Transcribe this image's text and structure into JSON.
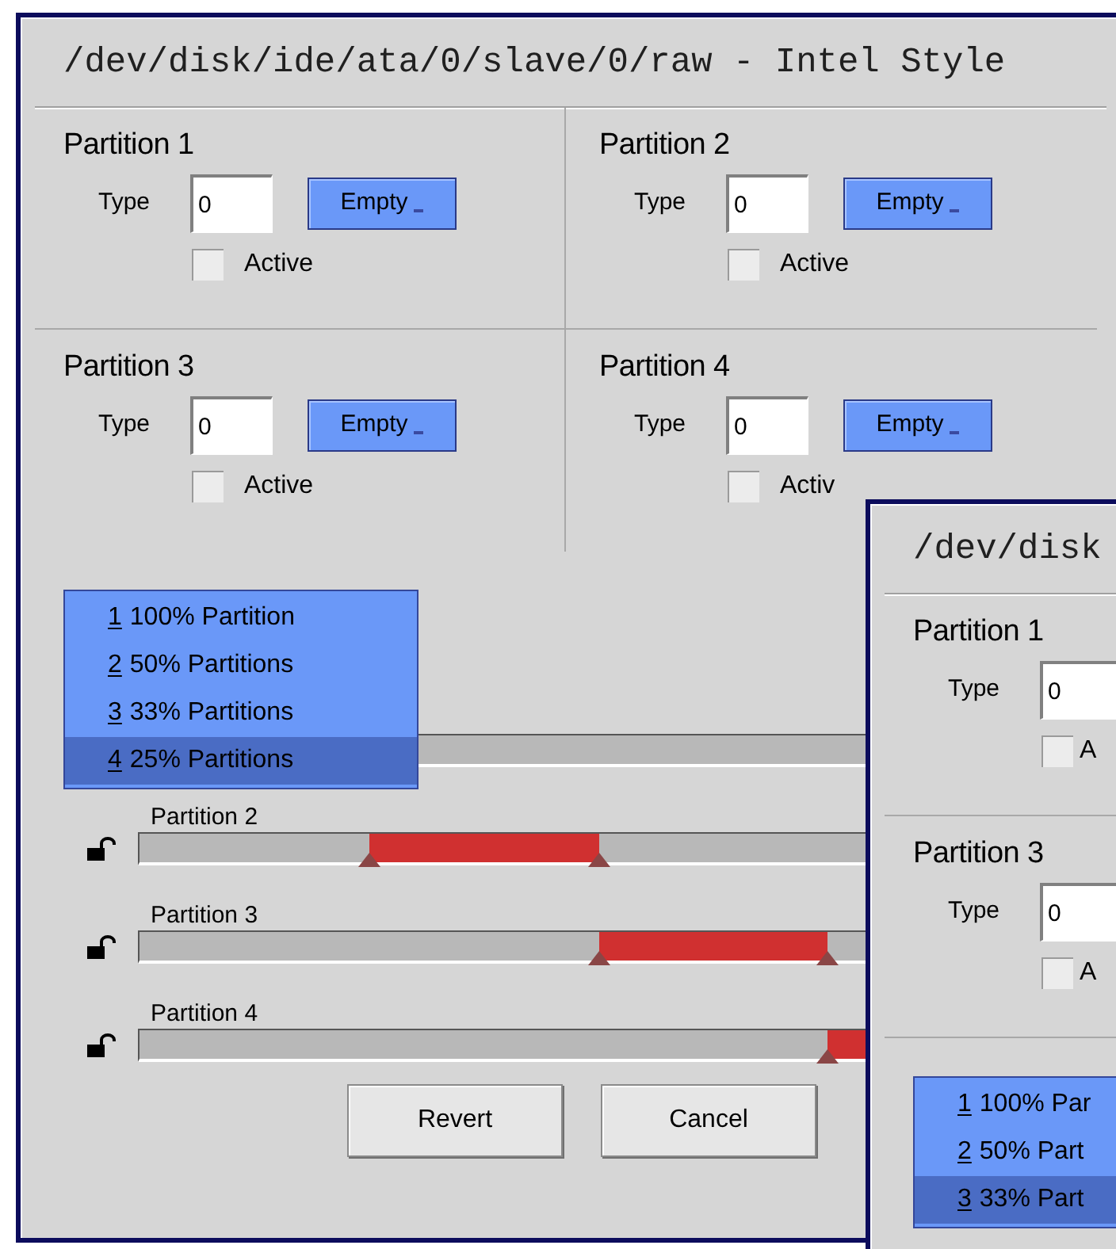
{
  "main_window": {
    "title": "/dev/disk/ide/ata/0/slave/0/raw - Intel Style",
    "partitions": [
      {
        "name": "Partition 1",
        "type_label": "Type",
        "type_value": "0",
        "menu_button": "Empty",
        "active_label": "Active",
        "active": false
      },
      {
        "name": "Partition 2",
        "type_label": "Type",
        "type_value": "0",
        "menu_button": "Empty",
        "active_label": "Active",
        "active": false
      },
      {
        "name": "Partition 3",
        "type_label": "Type",
        "type_value": "0",
        "menu_button": "Empty",
        "active_label": "Active",
        "active": false
      },
      {
        "name": "Partition 4",
        "type_label": "Type",
        "type_value": "0",
        "menu_button": "Empty",
        "active_label": "Activ",
        "active": false
      }
    ],
    "layout_menu": [
      {
        "key": "1",
        "label": "100% Partition",
        "selected": false
      },
      {
        "key": "2",
        "label": "50% Partitions",
        "selected": false
      },
      {
        "key": "3",
        "label": "33% Partitions",
        "selected": false
      },
      {
        "key": "4",
        "label": "25% Partitions",
        "selected": true
      }
    ],
    "sliders": [
      {
        "level": 0.25
      },
      {
        "label": "Partition 2",
        "level": 0.5
      },
      {
        "label": "Partition 3",
        "level": 0.75
      },
      {
        "label": "Partition 4",
        "level": 1
      }
    ],
    "buttons": [
      "Revert",
      "Cancel"
    ]
  },
  "front_window": {
    "title": "/dev/disk",
    "partitions": [
      {
        "name": "Partition 1",
        "type_label": "Type",
        "type_value": "0",
        "active_label": "A",
        "active": false
      },
      {
        "name": "Partition 3",
        "type_label": "Type",
        "type_value": "0",
        "active_label": "A",
        "active": false
      }
    ],
    "layout_menu": [
      {
        "key": "1",
        "label": "100% Par",
        "selected": false
      },
      {
        "key": "2",
        "label": "50% Part",
        "selected": false
      },
      {
        "key": "3",
        "label": "33% Part",
        "selected": true
      }
    ]
  }
}
